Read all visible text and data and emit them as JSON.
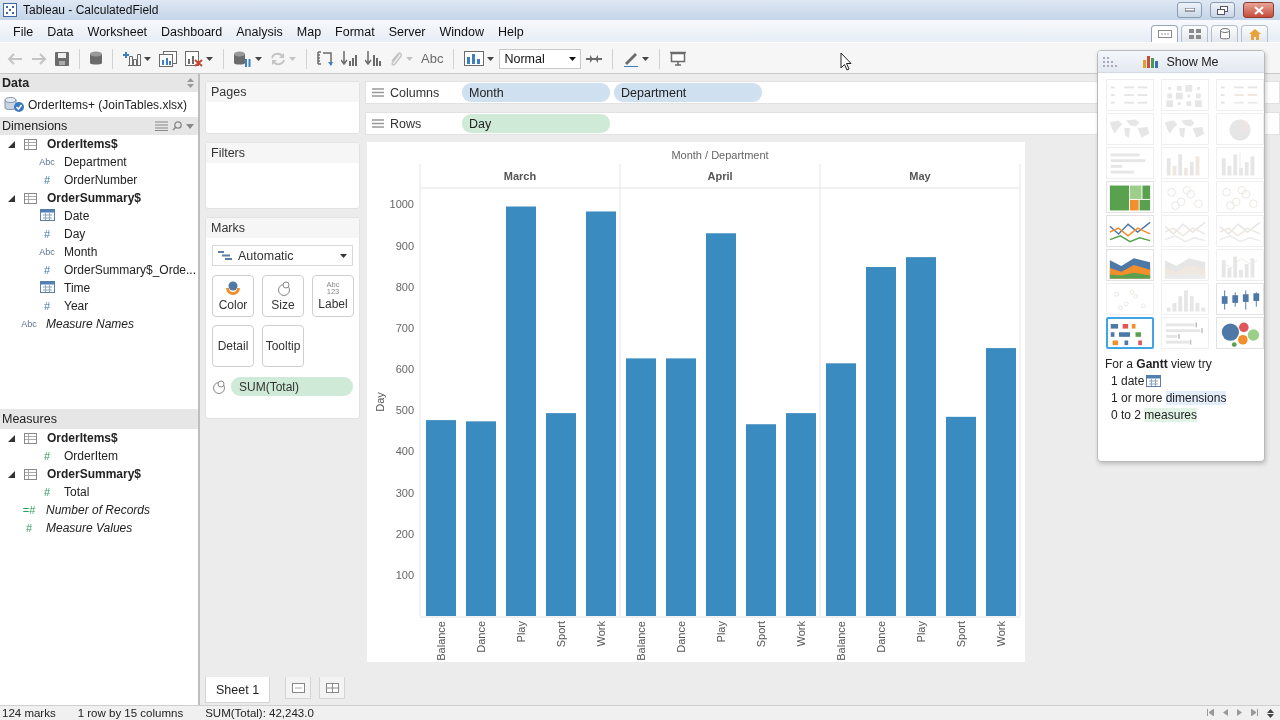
{
  "window": {
    "title": "Tableau - CalculatedField"
  },
  "menu": [
    "File",
    "Data",
    "Worksheet",
    "Dashboard",
    "Analysis",
    "Map",
    "Format",
    "Server",
    "Window",
    "Help"
  ],
  "workspace_tabs": [
    {
      "kind": "worksheet",
      "selected": true
    },
    {
      "kind": "dashboard",
      "selected": false
    },
    {
      "kind": "datasource",
      "selected": false
    },
    {
      "kind": "home",
      "selected": false
    }
  ],
  "toolbar": [
    {
      "kind": "back",
      "disabled": true,
      "dropdown": false
    },
    {
      "kind": "forward",
      "disabled": true,
      "dropdown": false
    },
    {
      "kind": "save",
      "disabled": false,
      "dropdown": false
    },
    {
      "kind": "separator"
    },
    {
      "kind": "database",
      "disabled": false,
      "dropdown": false
    },
    {
      "kind": "separator"
    },
    {
      "kind": "new-sheet",
      "disabled": false,
      "dropdown": true
    },
    {
      "kind": "duplicate",
      "disabled": false,
      "dropdown": false
    },
    {
      "kind": "clear",
      "disabled": false,
      "dropdown": true
    },
    {
      "kind": "separator"
    },
    {
      "kind": "pause",
      "disabled": false,
      "dropdown": true
    },
    {
      "kind": "refresh",
      "disabled": true,
      "dropdown": true
    },
    {
      "kind": "separator"
    },
    {
      "kind": "swap",
      "disabled": false,
      "dropdown": false
    },
    {
      "kind": "sort-asc",
      "disabled": false,
      "dropdown": false
    },
    {
      "kind": "sort-desc",
      "disabled": false,
      "dropdown": false
    },
    {
      "kind": "highlight",
      "disabled": true,
      "dropdown": true
    },
    {
      "kind": "labels",
      "label": "Abc",
      "disabled": false,
      "dropdown": false
    },
    {
      "kind": "separator"
    },
    {
      "kind": "show-cards",
      "disabled": false,
      "dropdown": true
    },
    {
      "kind": "fit",
      "value": "Normal",
      "disabled": false,
      "dropdown": true
    },
    {
      "kind": "pin",
      "disabled": false,
      "dropdown": false
    },
    {
      "kind": "separator"
    },
    {
      "kind": "pen",
      "disabled": false,
      "dropdown": true
    },
    {
      "kind": "separator"
    },
    {
      "kind": "presentation",
      "disabled": false,
      "dropdown": false
    }
  ],
  "data_pane": {
    "title": "Data",
    "source": "OrderItems+ (JoinTables.xlsx)",
    "dimensions": {
      "title": "Dimensions",
      "items": [
        {
          "label": "OrderItems$",
          "kind": "table",
          "expanded": true,
          "children": [
            {
              "label": "Department",
              "kind": "field",
              "type": "Abc",
              "generated": false
            },
            {
              "label": "OrderNumber",
              "kind": "field",
              "type": "#",
              "generated": false
            }
          ]
        },
        {
          "label": "OrderSummary$",
          "kind": "table",
          "expanded": true,
          "children": [
            {
              "label": "Date",
              "kind": "date",
              "generated": false
            },
            {
              "label": "Day",
              "kind": "field",
              "type": "#",
              "generated": false
            },
            {
              "label": "Month",
              "kind": "field",
              "type": "Abc",
              "generated": false
            },
            {
              "label": "OrderSummary$_Orde...",
              "kind": "field",
              "type": "#",
              "generated": false
            },
            {
              "label": "Time",
              "kind": "date",
              "generated": false
            },
            {
              "label": "Year",
              "kind": "field",
              "type": "#",
              "generated": false
            }
          ]
        },
        {
          "label": "Measure Names",
          "kind": "field",
          "type": "Abc",
          "generated": true
        }
      ]
    },
    "measures": {
      "title": "Measures",
      "items": [
        {
          "label": "OrderItems$",
          "kind": "table",
          "expanded": true,
          "children": [
            {
              "label": "OrderItem",
              "kind": "field",
              "type": "#",
              "generated": false
            }
          ]
        },
        {
          "label": "OrderSummary$",
          "kind": "table",
          "expanded": true,
          "children": [
            {
              "label": "Total",
              "kind": "field",
              "type": "#",
              "generated": false
            }
          ]
        },
        {
          "label": "Number of Records",
          "kind": "field",
          "type": "=#",
          "generated": true
        },
        {
          "label": "Measure Values",
          "kind": "field",
          "type": "#",
          "generated": true
        }
      ]
    }
  },
  "cards": {
    "pages": {
      "title": "Pages"
    },
    "filters": {
      "title": "Filters"
    },
    "marks": {
      "title": "Marks",
      "mark_type": "Automatic",
      "buttons": [
        {
          "kind": "color",
          "label": "Color"
        },
        {
          "kind": "size",
          "label": "Size"
        },
        {
          "kind": "label",
          "label": "Label",
          "icon_text": [
            "Abc",
            "123"
          ]
        },
        {
          "kind": "plain",
          "label": "Detail"
        },
        {
          "kind": "plain",
          "label": "Tooltip"
        }
      ],
      "pills": [
        {
          "kind": "size",
          "label": "SUM(Total)"
        }
      ]
    }
  },
  "shelves": [
    {
      "label": "Columns",
      "pills": [
        {
          "label": "Month",
          "continuous": false
        },
        {
          "label": "Department",
          "continuous": false
        }
      ]
    },
    {
      "label": "Rows",
      "pills": [
        {
          "label": "Day",
          "continuous": true
        }
      ]
    }
  ],
  "view": {
    "panes": [
      "March",
      "April",
      "May"
    ],
    "chart_data": {
      "type": "bar",
      "title": "Month / Department",
      "ylabel": "Day",
      "categories": [
        "Balance",
        "Dance",
        "Play",
        "Sport",
        "Work",
        "Balance",
        "Dance",
        "Play",
        "Sport",
        "Work",
        "Balance",
        "Dance",
        "Play",
        "Sport",
        "Work"
      ],
      "values": [
        476,
        473,
        995,
        493,
        983,
        626,
        626,
        930,
        466,
        493,
        614,
        848,
        872,
        484,
        651
      ],
      "ylim": [
        0,
        1040
      ],
      "yticks": [
        100,
        200,
        300,
        400,
        500,
        600,
        700,
        800,
        900,
        1000
      ]
    }
  },
  "show_me": {
    "title": "Show Me",
    "charts": [
      {
        "kind": "text-table",
        "disabled": true,
        "selected": false
      },
      {
        "kind": "heat-map",
        "disabled": true,
        "selected": false
      },
      {
        "kind": "highlight-table",
        "disabled": true,
        "selected": false
      },
      {
        "kind": "symbol-map",
        "disabled": true,
        "selected": false
      },
      {
        "kind": "filled-map",
        "disabled": true,
        "selected": false
      },
      {
        "kind": "pie",
        "disabled": true,
        "selected": false
      },
      {
        "kind": "hbar",
        "disabled": true,
        "selected": false
      },
      {
        "kind": "stacked-bar",
        "disabled": true,
        "selected": false
      },
      {
        "kind": "side-bar",
        "disabled": true,
        "selected": false
      },
      {
        "kind": "treemap",
        "disabled": false,
        "selected": false
      },
      {
        "kind": "circle",
        "disabled": true,
        "selected": false
      },
      {
        "kind": "side-circle",
        "disabled": true,
        "selected": false
      },
      {
        "kind": "line",
        "disabled": false,
        "selected": false
      },
      {
        "kind": "dual-line",
        "disabled": true,
        "selected": false
      },
      {
        "kind": "line",
        "disabled": true,
        "selected": false
      },
      {
        "kind": "area",
        "disabled": false,
        "selected": false
      },
      {
        "kind": "area",
        "disabled": true,
        "selected": false
      },
      {
        "kind": "combo",
        "disabled": true,
        "selected": false
      },
      {
        "kind": "scatter",
        "disabled": true,
        "selected": false
      },
      {
        "kind": "histogram",
        "disabled": true,
        "selected": false
      },
      {
        "kind": "box",
        "disabled": false,
        "selected": false
      },
      {
        "kind": "gantt",
        "disabled": false,
        "selected": true
      },
      {
        "kind": "bullet",
        "disabled": true,
        "selected": false
      },
      {
        "kind": "bubbles",
        "disabled": false,
        "selected": false
      }
    ],
    "hint": "For a **Gantt** view try",
    "requirements": [
      {
        "kind": "date",
        "text": "1 date"
      },
      {
        "kind": "dimension",
        "text": "1 or more ",
        "highlight": "dimensions"
      },
      {
        "kind": "measure",
        "text": "0 to 2 ",
        "highlight": "measures"
      }
    ]
  },
  "sheet_tabs": [
    {
      "label": "Sheet 1",
      "selected": true
    }
  ],
  "status_bar": [
    "124 marks",
    "1 row by 15 columns",
    "SUM(Total): 42,243.0"
  ]
}
